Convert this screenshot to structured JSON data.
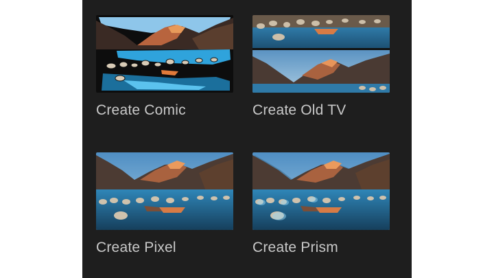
{
  "effects": [
    {
      "label": "Create Comic",
      "style": "comic"
    },
    {
      "label": "Create Old TV",
      "style": "oldtv"
    },
    {
      "label": "Create Pixel",
      "style": "pixel"
    },
    {
      "label": "Create Prism",
      "style": "prism"
    }
  ],
  "colors": {
    "panel_background": "#1e1e1e",
    "label_text": "#c9c9c9",
    "sky": "#7fb6dc",
    "water": "#2e7aa8",
    "mountain_dark": "#4a3a33",
    "mountain_lit": "#d07a4a"
  }
}
